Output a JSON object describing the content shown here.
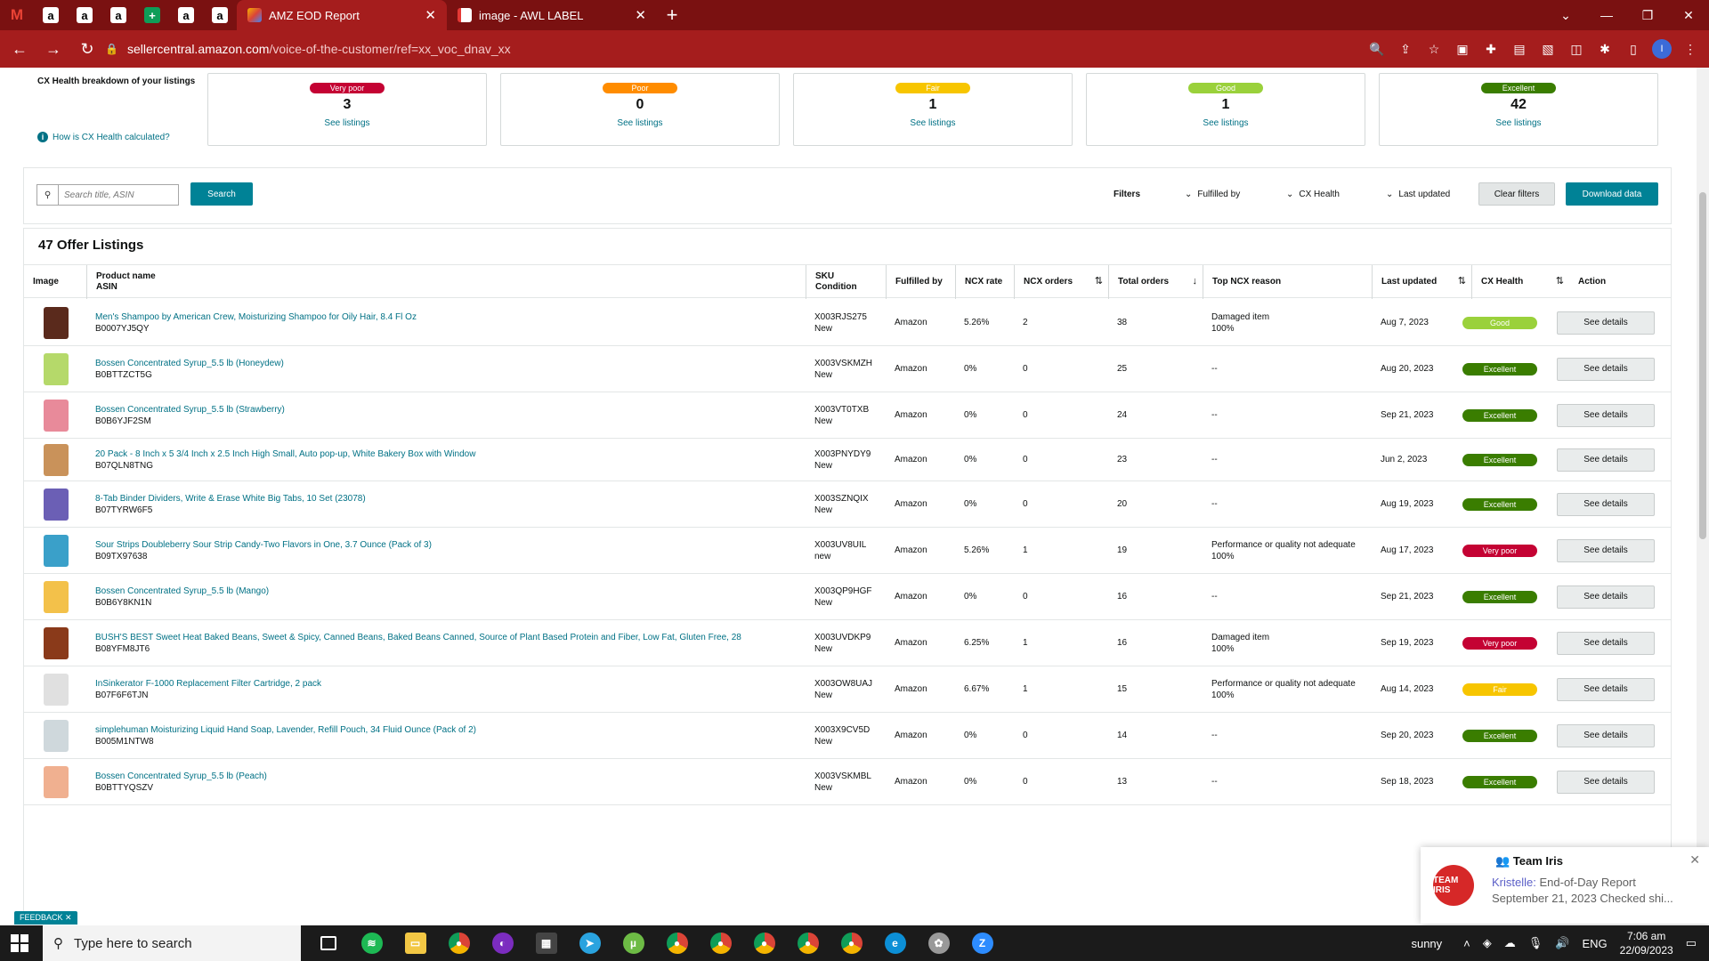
{
  "browser": {
    "pinned_tabs": [
      "M",
      "a",
      "a",
      "a",
      "+",
      "a",
      "a"
    ],
    "tabs": [
      {
        "title": "AMZ EOD Report",
        "active": true
      },
      {
        "title": "image - AWL LABEL",
        "active": false
      }
    ],
    "url_host": "sellercentral.amazon.com",
    "url_path": "/voice-of-the-customer/ref=xx_voc_dnav_xx"
  },
  "cx": {
    "label": "CX Health breakdown of your listings",
    "help_link": "How is CX Health calculated?",
    "cards": [
      {
        "badge": "Very poor",
        "count": "3",
        "link": "See listings",
        "color": "#c40233"
      },
      {
        "badge": "Poor",
        "count": "0",
        "link": "See listings",
        "color": "#ff8c00"
      },
      {
        "badge": "Fair",
        "count": "1",
        "link": "See listings",
        "color": "#f7c500"
      },
      {
        "badge": "Good",
        "count": "1",
        "link": "See listings",
        "color": "#9ad13b"
      },
      {
        "badge": "Excellent",
        "count": "42",
        "link": "See listings",
        "color": "#3a7d00"
      }
    ]
  },
  "search": {
    "placeholder": "Search title, ASIN",
    "button": "Search",
    "filters_label": "Filters",
    "dropdowns": [
      "Fulfilled by",
      "CX Health",
      "Last updated"
    ],
    "clear": "Clear filters",
    "download": "Download data"
  },
  "table": {
    "title": "47 Offer Listings",
    "headers": {
      "image": "Image",
      "product": "Product name",
      "asin": "ASIN",
      "sku": "SKU",
      "condition": "Condition",
      "fulfilled": "Fulfilled by",
      "ncx_rate": "NCX rate",
      "ncx_orders": "NCX orders",
      "total_orders": "Total orders",
      "top_reason": "Top NCX reason",
      "last_updated": "Last updated",
      "cx_health": "CX Health",
      "action": "Action"
    },
    "rows": [
      {
        "name": "Men's Shampoo by American Crew, Moisturizing Shampoo for Oily Hair, 8.4 Fl Oz",
        "asin": "B0007YJ5QY",
        "sku": "X003RJS275",
        "cond": "New",
        "fulfilled": "Amazon",
        "rate": "5.26%",
        "ncx": "2",
        "total": "38",
        "reason": "Damaged item",
        "reason_pct": "100%",
        "updated": "Aug 7, 2023",
        "health": "Good",
        "health_color": "#9ad13b",
        "action": "See details"
      },
      {
        "name": "Bossen Concentrated Syrup_5.5 lb (Honeydew)",
        "asin": "B0BTTZCT5G",
        "sku": "X003VSKMZH",
        "cond": "New",
        "fulfilled": "Amazon",
        "rate": "0%",
        "ncx": "0",
        "total": "25",
        "reason": "--",
        "reason_pct": "",
        "updated": "Aug 20, 2023",
        "health": "Excellent",
        "health_color": "#3a7d00",
        "action": "See details"
      },
      {
        "name": "Bossen Concentrated Syrup_5.5 lb (Strawberry)",
        "asin": "B0B6YJF2SM",
        "sku": "X003VT0TXB",
        "cond": "New",
        "fulfilled": "Amazon",
        "rate": "0%",
        "ncx": "0",
        "total": "24",
        "reason": "--",
        "reason_pct": "",
        "updated": "Sep 21, 2023",
        "health": "Excellent",
        "health_color": "#3a7d00",
        "action": "See details"
      },
      {
        "name": "20 Pack - 8 Inch x 5 3/4 Inch x 2.5 Inch High Small, Auto pop-up, White Bakery Box with Window",
        "asin": "B07QLN8TNG",
        "sku": "X003PNYDY9",
        "cond": "New",
        "fulfilled": "Amazon",
        "rate": "0%",
        "ncx": "0",
        "total": "23",
        "reason": "--",
        "reason_pct": "",
        "updated": "Jun 2, 2023",
        "health": "Excellent",
        "health_color": "#3a7d00",
        "action": "See details"
      },
      {
        "name": "8-Tab Binder Dividers, Write & Erase White Big Tabs, 10 Set (23078)",
        "asin": "B07TYRW6F5",
        "sku": "X003SZNQIX",
        "cond": "New",
        "fulfilled": "Amazon",
        "rate": "0%",
        "ncx": "0",
        "total": "20",
        "reason": "--",
        "reason_pct": "",
        "updated": "Aug 19, 2023",
        "health": "Excellent",
        "health_color": "#3a7d00",
        "action": "See details"
      },
      {
        "name": "Sour Strips Doubleberry Sour Strip Candy-Two Flavors in One, 3.7 Ounce (Pack of 3)",
        "asin": "B09TX97638",
        "sku": "X003UV8UIL",
        "cond": "new",
        "fulfilled": "Amazon",
        "rate": "5.26%",
        "ncx": "1",
        "total": "19",
        "reason": "Performance or quality not adequate",
        "reason_pct": "100%",
        "updated": "Aug 17, 2023",
        "health": "Very poor",
        "health_color": "#c40233",
        "action": "See details"
      },
      {
        "name": "Bossen Concentrated Syrup_5.5 lb (Mango)",
        "asin": "B0B6Y8KN1N",
        "sku": "X003QP9HGF",
        "cond": "New",
        "fulfilled": "Amazon",
        "rate": "0%",
        "ncx": "0",
        "total": "16",
        "reason": "--",
        "reason_pct": "",
        "updated": "Sep 21, 2023",
        "health": "Excellent",
        "health_color": "#3a7d00",
        "action": "See details"
      },
      {
        "name": "BUSH'S BEST Sweet Heat Baked Beans, Sweet & Spicy, Canned Beans, Baked Beans Canned, Source of Plant Based Protein and Fiber, Low Fat, Gluten Free, 28",
        "asin": "B08YFM8JT6",
        "sku": "X003UVDKP9",
        "cond": "New",
        "fulfilled": "Amazon",
        "rate": "6.25%",
        "ncx": "1",
        "total": "16",
        "reason": "Damaged item",
        "reason_pct": "100%",
        "updated": "Sep 19, 2023",
        "health": "Very poor",
        "health_color": "#c40233",
        "action": "See details"
      },
      {
        "name": "InSinkerator F-1000 Replacement Filter Cartridge, 2 pack",
        "asin": "B07F6F6TJN",
        "sku": "X003OW8UAJ",
        "cond": "New",
        "fulfilled": "Amazon",
        "rate": "6.67%",
        "ncx": "1",
        "total": "15",
        "reason": "Performance or quality not adequate",
        "reason_pct": "100%",
        "updated": "Aug 14, 2023",
        "health": "Fair",
        "health_color": "#f7c500",
        "action": "See details"
      },
      {
        "name": "simplehuman Moisturizing Liquid Hand Soap, Lavender, Refill Pouch, 34 Fluid Ounce (Pack of 2)",
        "asin": "B005M1NTW8",
        "sku": "X003X9CV5D",
        "cond": "New",
        "fulfilled": "Amazon",
        "rate": "0%",
        "ncx": "0",
        "total": "14",
        "reason": "--",
        "reason_pct": "",
        "updated": "Sep 20, 2023",
        "health": "Excellent",
        "health_color": "#3a7d00",
        "action": "See details"
      },
      {
        "name": "Bossen Concentrated Syrup_5.5 lb (Peach)",
        "asin": "B0BTTYQSZV",
        "sku": "X003VSKMBL",
        "cond": "New",
        "fulfilled": "Amazon",
        "rate": "0%",
        "ncx": "0",
        "total": "13",
        "reason": "--",
        "reason_pct": "",
        "updated": "Sep 18, 2023",
        "health": "Excellent",
        "health_color": "#3a7d00",
        "action": "See details"
      }
    ]
  },
  "feedback": "FEEDBACK",
  "toast": {
    "title": "Team Iris",
    "sender": "Kristelle:",
    "message": "End-of-Day Report",
    "line2": "September 21, 2023  Checked shi...",
    "logo_text": "TEAM IRIS"
  },
  "taskbar": {
    "search_placeholder": "Type here to search",
    "weather": "sunny",
    "lang": "ENG",
    "time": "7:06 am",
    "date": "22/09/2023"
  }
}
